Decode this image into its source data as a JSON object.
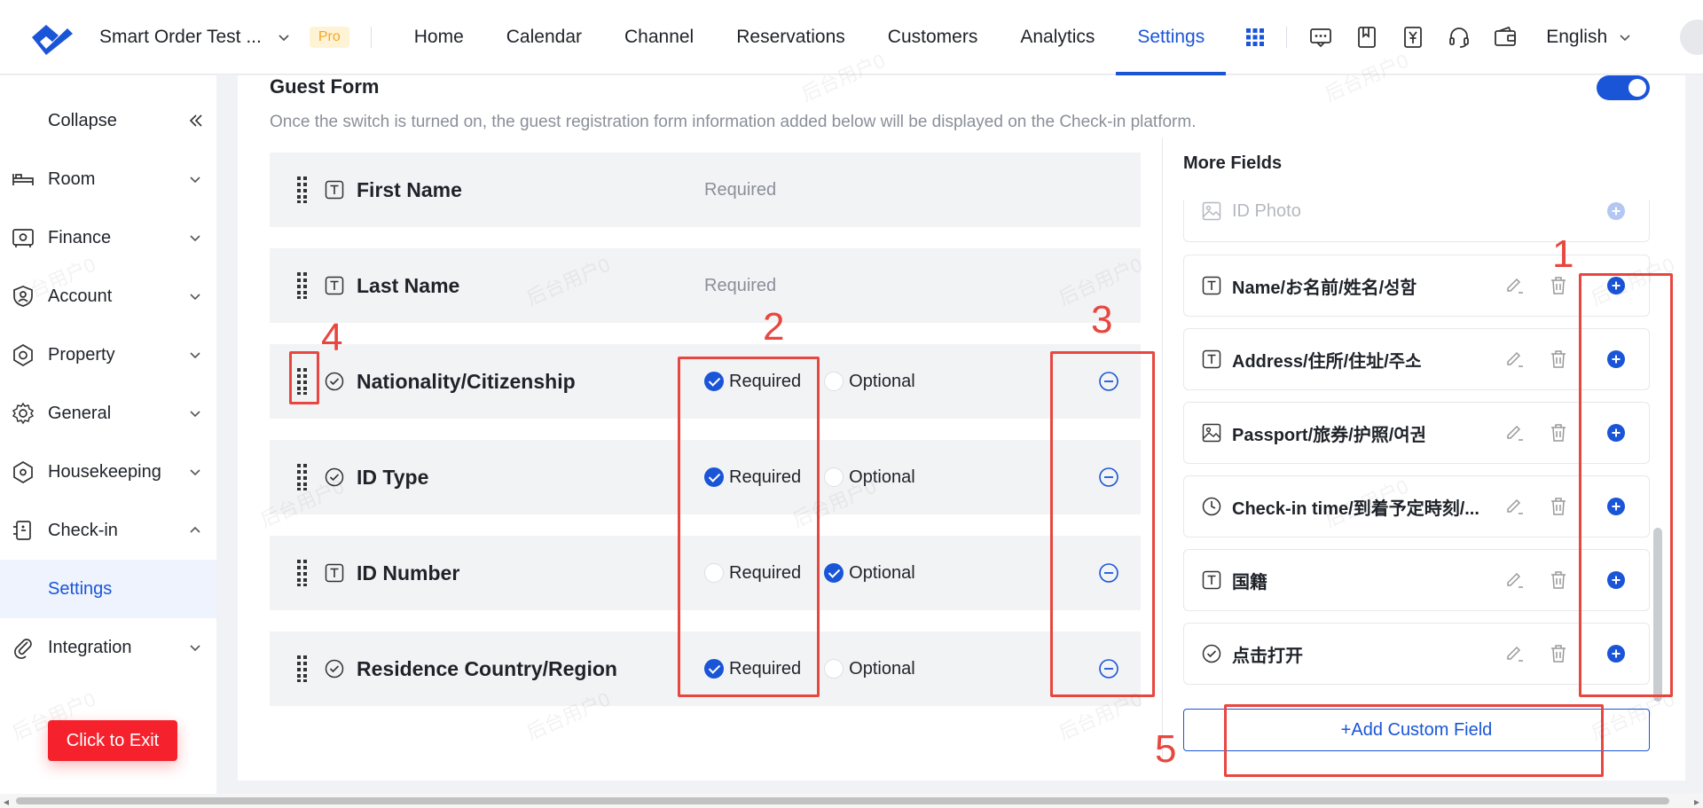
{
  "nav": {
    "store_name": "Smart Order Test ...",
    "badge": "Pro",
    "items": [
      {
        "label": "Home",
        "active": false
      },
      {
        "label": "Calendar",
        "active": false
      },
      {
        "label": "Channel",
        "active": false
      },
      {
        "label": "Reservations",
        "active": false
      },
      {
        "label": "Customers",
        "active": false
      },
      {
        "label": "Analytics",
        "active": false
      },
      {
        "label": "Settings",
        "active": true
      }
    ],
    "tool_icons": [
      "message-icon",
      "bookmark-icon",
      "invoice-yen-icon",
      "headset-icon",
      "wallet-icon"
    ],
    "language": "English"
  },
  "sidebar": {
    "collapse_label": "Collapse",
    "items": [
      {
        "label": "Room",
        "icon": "bed-icon",
        "expanded": false
      },
      {
        "label": "Finance",
        "icon": "safe-icon",
        "expanded": false
      },
      {
        "label": "Account",
        "icon": "user-shield-icon",
        "expanded": false
      },
      {
        "label": "Property",
        "icon": "property-icon",
        "expanded": false
      },
      {
        "label": "General",
        "icon": "gear-icon",
        "expanded": false
      },
      {
        "label": "Housekeeping",
        "icon": "housekeeping-icon",
        "expanded": false
      },
      {
        "label": "Check-in",
        "icon": "checkin-icon",
        "expanded": true
      }
    ],
    "sub_item": "Settings",
    "integration_label": "Integration",
    "exit_label": "Click to Exit"
  },
  "guest_form": {
    "title": "Guest Form",
    "description": "Once the switch is turned on, the guest registration form information added below will be displayed on the Check-in platform.",
    "switch_on": true,
    "fields": [
      {
        "name": "First Name",
        "type": "text",
        "mode": "static",
        "static_label": "Required"
      },
      {
        "name": "Last Name",
        "type": "text",
        "mode": "static",
        "static_label": "Required"
      },
      {
        "name": "Nationality/Citizenship",
        "type": "choice",
        "mode": "radio",
        "selected": "required"
      },
      {
        "name": "ID Type",
        "type": "choice",
        "mode": "radio",
        "selected": "required"
      },
      {
        "name": "ID Number",
        "type": "text",
        "mode": "radio",
        "selected": "optional"
      },
      {
        "name": "Residence Country/Region",
        "type": "choice",
        "mode": "radio",
        "selected": "required"
      }
    ],
    "required_label": "Required",
    "optional_label": "Optional"
  },
  "more_fields": {
    "title": "More Fields",
    "items": [
      {
        "name": "ID Photo",
        "type": "image",
        "faded": true
      },
      {
        "name": "Name/お名前/姓名/성함",
        "type": "text",
        "faded": false
      },
      {
        "name": "Address/住所/住址/주소",
        "type": "text",
        "faded": false
      },
      {
        "name": "Passport/旅券/护照/여권",
        "type": "image",
        "faded": false
      },
      {
        "name": "Check-in time/到着予定時刻/...",
        "type": "time",
        "faded": false
      },
      {
        "name": "国籍",
        "type": "text",
        "faded": false
      },
      {
        "name": "点击打开",
        "type": "choice",
        "faded": false
      }
    ],
    "add_custom_label": "+Add Custom Field"
  },
  "annotations": [
    "1",
    "2",
    "3",
    "4",
    "5"
  ],
  "watermark": "后台用户0",
  "colors": {
    "primary": "#1a55d8",
    "annotation": "#e8473f",
    "exit": "#f5222d",
    "pro_bg": "#fff3d6",
    "pro_text": "#f5a623"
  }
}
